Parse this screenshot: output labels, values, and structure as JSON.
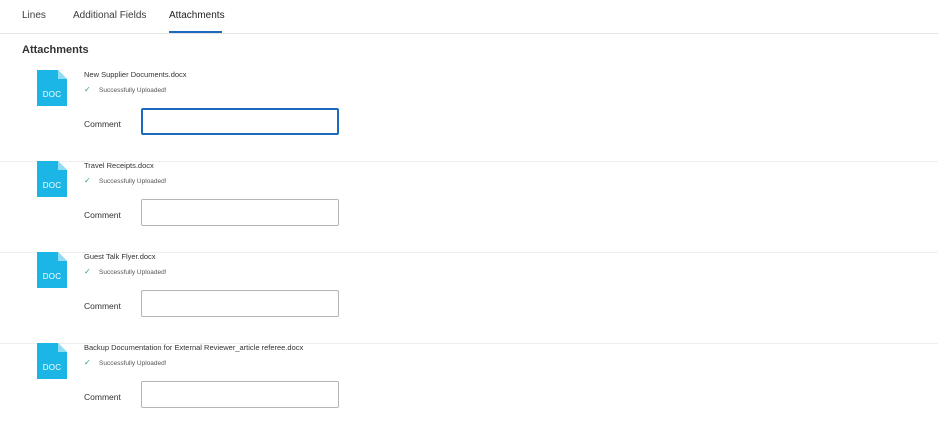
{
  "tabs": [
    {
      "label": "Lines"
    },
    {
      "label": "Additional Fields"
    },
    {
      "label": "Attachments",
      "active": true
    }
  ],
  "section_title": "Attachments",
  "doc_icon_label": "DOC",
  "accent_color": "#1a6bbf",
  "doc_icon_color": "#1cb6e6",
  "attachments": [
    {
      "file_name": "New Supplier Documents.docx",
      "status": "Successfully Uploaded!",
      "comment_label": "Comment",
      "comment_value": ""
    },
    {
      "file_name": "Travel Receipts.docx",
      "status": "Successfully Uploaded!",
      "comment_label": "Comment",
      "comment_value": ""
    },
    {
      "file_name": "Guest Talk Flyer.docx",
      "status": "Successfully Uploaded!",
      "comment_label": "Comment",
      "comment_value": ""
    },
    {
      "file_name": "Backup Documentation for External Reviewer_article referee.docx",
      "status": "Successfully Uploaded!",
      "comment_label": "Comment",
      "comment_value": ""
    }
  ],
  "icons": {
    "file": "doc-file-icon",
    "status": "checkmark-icon"
  }
}
